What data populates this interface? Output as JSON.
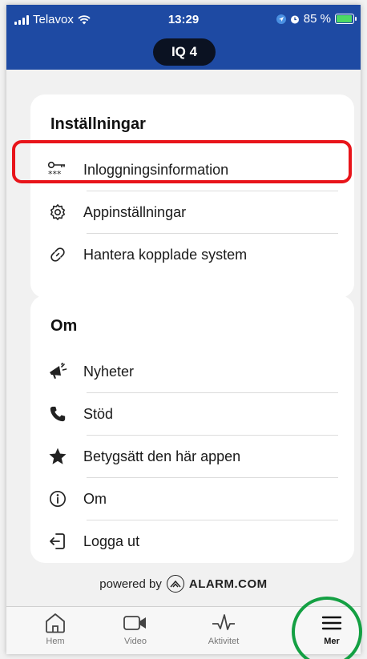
{
  "status_bar": {
    "carrier": "Telavox",
    "time": "13:29",
    "battery": "85 %",
    "battery_level": 0.85
  },
  "header": {
    "system_name": "IQ 4"
  },
  "settings": {
    "title": "Inställningar",
    "items": [
      {
        "label": "Inloggningsinformation",
        "icon": "key-icon"
      },
      {
        "label": "Appinställningar",
        "icon": "gear-icon"
      },
      {
        "label": "Hantera kopplade system",
        "icon": "link-icon"
      }
    ]
  },
  "about": {
    "title": "Om",
    "items": [
      {
        "label": "Nyheter",
        "icon": "megaphone-icon"
      },
      {
        "label": "Stöd",
        "icon": "phone-icon"
      },
      {
        "label": "Betygsätt den här appen",
        "icon": "star-icon"
      },
      {
        "label": "Om",
        "icon": "info-icon"
      },
      {
        "label": "Logga ut",
        "icon": "logout-icon"
      }
    ]
  },
  "footer": {
    "powered_by": "powered by",
    "brand": "ALARM.COM"
  },
  "tabbar": {
    "tabs": [
      {
        "label": "Hem",
        "icon": "home-icon"
      },
      {
        "label": "Video",
        "icon": "video-camera-icon"
      },
      {
        "label": "Aktivitet",
        "icon": "activity-icon"
      },
      {
        "label": "Mer",
        "icon": "menu-icon",
        "active": true
      }
    ]
  },
  "colors": {
    "header": "#1e4aa3",
    "highlight": "#e8141a",
    "active_circle": "#14a043"
  }
}
